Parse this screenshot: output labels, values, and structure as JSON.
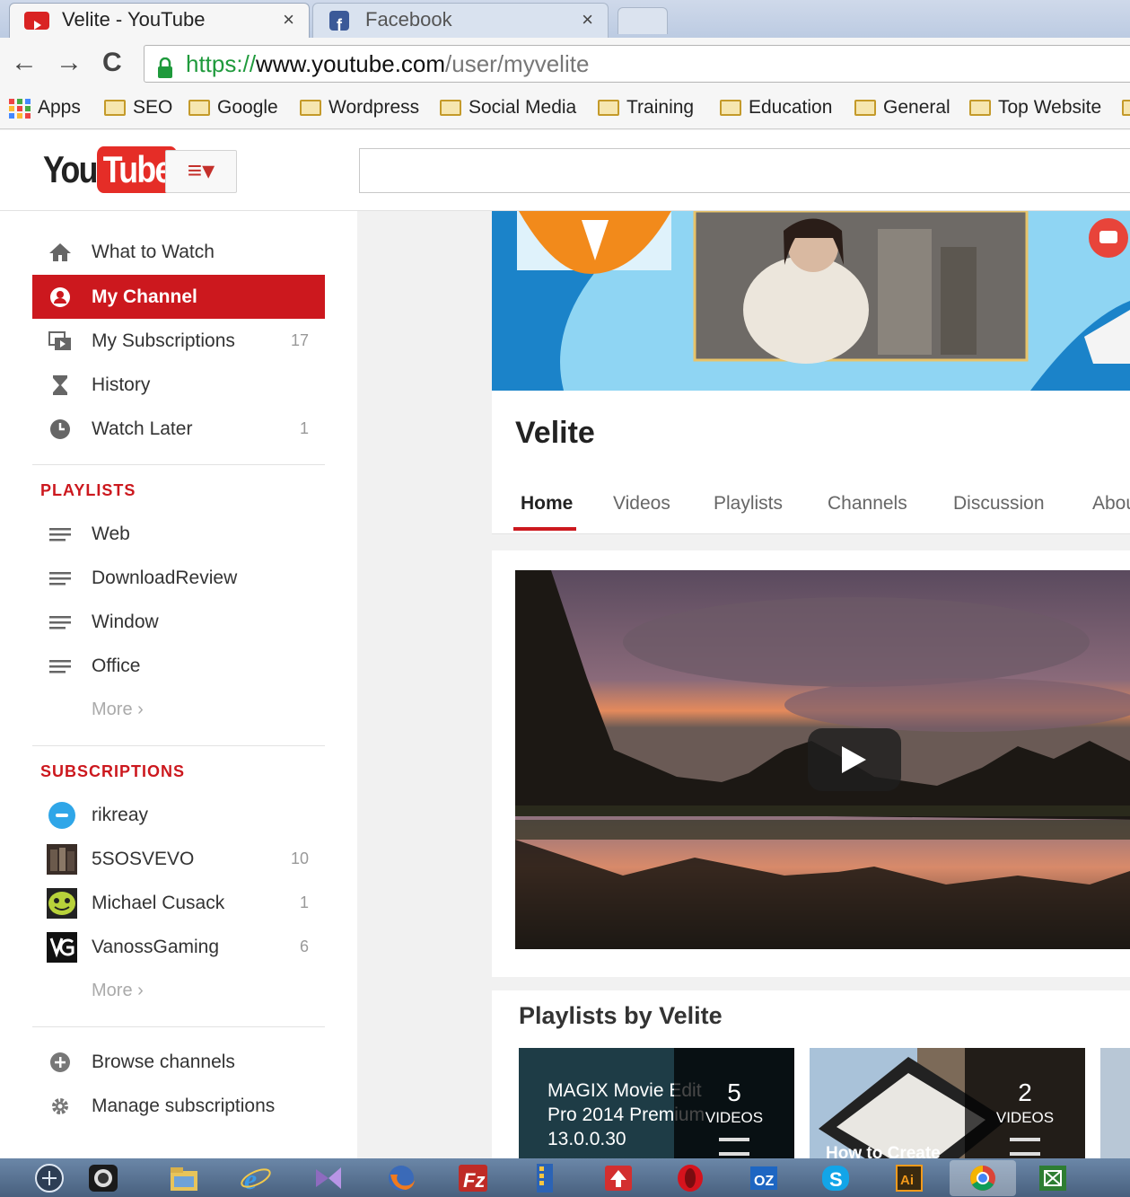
{
  "browser": {
    "tabs": [
      {
        "title": "Velite - YouTube",
        "close": "×",
        "favicon": "youtube-icon"
      },
      {
        "title": "Facebook",
        "close": "×",
        "favicon": "facebook-icon"
      }
    ],
    "url": {
      "scheme": "https://",
      "host": "www.youtube.com",
      "path": "/user/myvelite"
    },
    "nav": {
      "back": "←",
      "forward": "→",
      "reload": "C"
    },
    "bookmarks": [
      "Apps",
      "SEO",
      "Google",
      "Wordpress",
      "Social Media",
      "Training",
      "Education",
      "General",
      "Top Website"
    ]
  },
  "youtube": {
    "logo_you": "You",
    "logo_tube": "Tube",
    "guide_button": "≡▾"
  },
  "sidebar": {
    "main_items": [
      {
        "label": "What to Watch",
        "icon": "home-icon",
        "count": ""
      },
      {
        "label": "My Channel",
        "icon": "user-icon",
        "count": ""
      },
      {
        "label": "My Subscriptions",
        "icon": "subscriptions-icon",
        "count": "17"
      },
      {
        "label": "History",
        "icon": "hourglass-icon",
        "count": ""
      },
      {
        "label": "Watch Later",
        "icon": "clock-icon",
        "count": "1"
      }
    ],
    "playlists_title": "PLAYLISTS",
    "playlists": [
      "Web",
      "DownloadReview",
      "Window",
      "Office"
    ],
    "playlists_more": "More ›",
    "subscriptions_title": "SUBSCRIPTIONS",
    "subscriptions": [
      {
        "name": "rikreay",
        "count": ""
      },
      {
        "name": "5SOSVEVO",
        "count": "10"
      },
      {
        "name": "Michael Cusack",
        "count": "1"
      },
      {
        "name": "VanossGaming",
        "count": "6"
      }
    ],
    "subscriptions_more": "More ›",
    "footer_items": [
      {
        "label": "Browse channels",
        "icon": "plus-circle-icon"
      },
      {
        "label": "Manage subscriptions",
        "icon": "gear-icon"
      }
    ]
  },
  "channel": {
    "name": "Velite",
    "tabs": [
      "Home",
      "Videos",
      "Playlists",
      "Channels",
      "Discussion",
      "Abou"
    ],
    "active_tab": "Home",
    "playlists_heading": "Playlists by Velite",
    "playlists": [
      {
        "text": "MAGIX Movie Edit Pro 2014 Premium 13.0.0.30",
        "count": "5",
        "unit": "VIDEOS"
      },
      {
        "text": "How to Create",
        "count": "2",
        "unit": "VIDEOS"
      }
    ]
  },
  "colors": {
    "brand_red": "#cc181e",
    "link_green": "#1f9a3c"
  }
}
